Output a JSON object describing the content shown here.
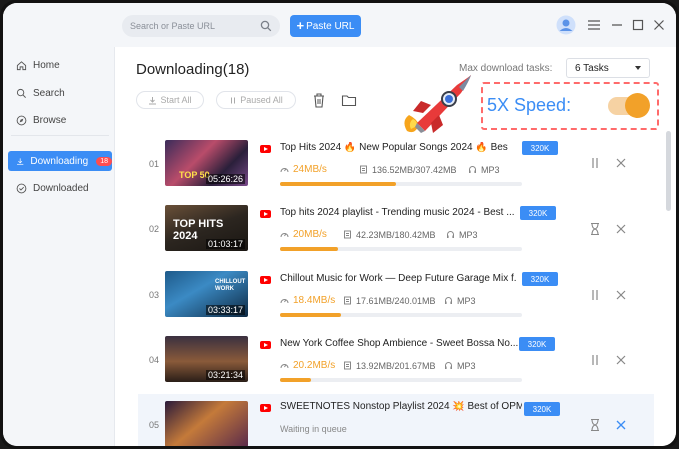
{
  "search": {
    "placeholder": "Search or Paste URL"
  },
  "paste_button": {
    "plus": "+",
    "label": "Paste URL"
  },
  "sidebar": {
    "items": [
      {
        "label": "Home",
        "icon": "home-icon"
      },
      {
        "label": "Search",
        "icon": "search-icon"
      },
      {
        "label": "Browse",
        "icon": "compass-icon"
      },
      {
        "label": "Downloading",
        "icon": "download-icon",
        "badge": "18",
        "active": true
      },
      {
        "label": "Downloaded",
        "icon": "check-circle-icon"
      }
    ]
  },
  "main": {
    "title": "Downloading(18)",
    "max_tasks_label": "Max download tasks:",
    "max_tasks_value": "6 Tasks",
    "start_all": "Start All",
    "paused_all": "Paused All",
    "speed_label": "5X Speed:",
    "speed_toggle_on": true
  },
  "colors": {
    "accent": "#3b8df5",
    "progress": "#f2a129",
    "badge": "#ff4d4f",
    "highlight_border": "#ff6b6b"
  },
  "rows": [
    {
      "index": "01",
      "title": "Top Hits 2024 🔥 New Popular Songs 2024 🔥 Best En...",
      "quality": "320K",
      "duration": "05:26:26",
      "speed": "24MB/s",
      "size": "136.52MB/307.42MB",
      "format": "MP3",
      "progress": 0.48,
      "state": "downloading"
    },
    {
      "index": "02",
      "title": "Top hits 2024 playlist - Trending music 2024 - Best ...",
      "quality": "320K",
      "duration": "01:03:17",
      "speed": "20MB/s",
      "size": "42.23MB/180.42MB",
      "format": "MP3",
      "progress": 0.24,
      "state": "waiting-speed"
    },
    {
      "index": "03",
      "title": "Chillout Music for Work — Deep Future Garage Mix f...",
      "quality": "320K",
      "duration": "03:33:17",
      "speed": "18.4MB/s",
      "size": "17.61MB/240.01MB",
      "format": "MP3",
      "progress": 0.25,
      "state": "downloading"
    },
    {
      "index": "04",
      "title": "New York Coffee Shop Ambience - Sweet Bossa No...",
      "quality": "320K",
      "duration": "03:21:34",
      "speed": "20.2MB/s",
      "size": "13.92MB/201.67MB",
      "format": "MP3",
      "progress": 0.13,
      "state": "downloading"
    },
    {
      "index": "05",
      "title": "SWEETNOTES Nonstop Playlist 2024 💥 Best of OPM L...",
      "quality": "320K",
      "duration": "",
      "status": "Waiting in queue",
      "state": "queued"
    }
  ]
}
